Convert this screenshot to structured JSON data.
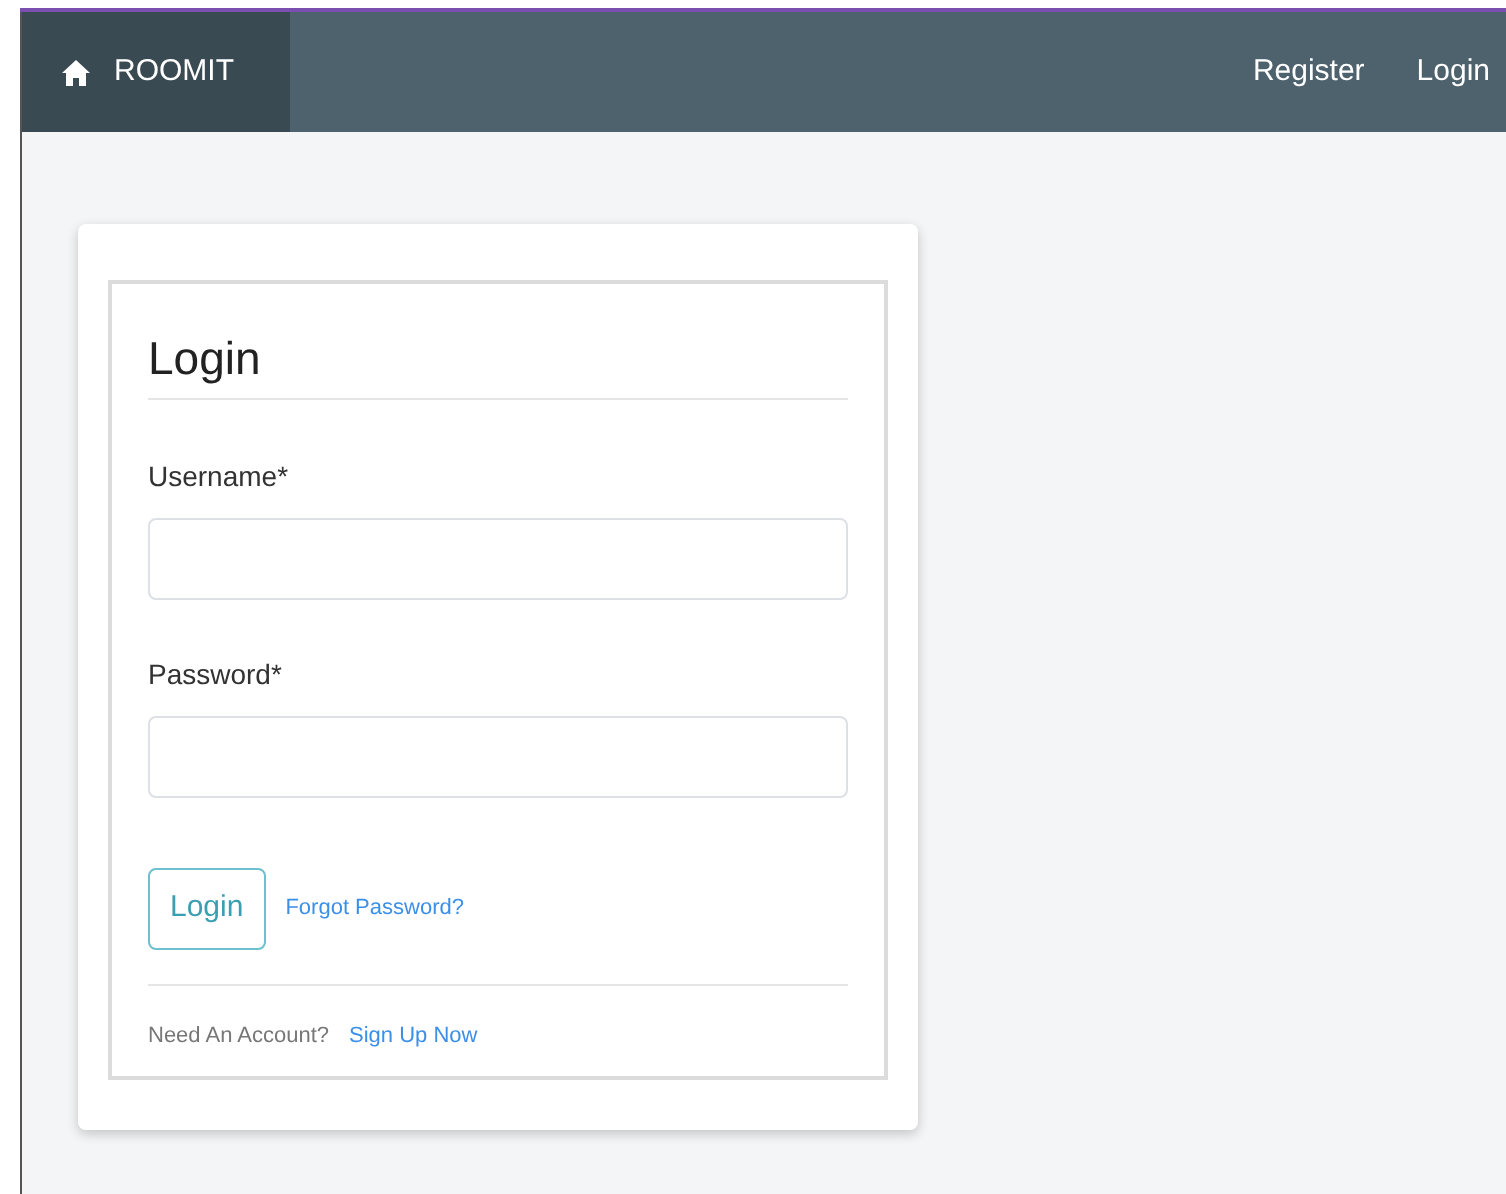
{
  "navbar": {
    "brand": "ROOMIT",
    "links": [
      "Register",
      "Login"
    ]
  },
  "login": {
    "title": "Login",
    "fields": [
      {
        "label": "Username*"
      },
      {
        "label": "Password*"
      }
    ],
    "submit": "Login",
    "forgot": "Forgot Password?",
    "footer_text": "Need An Account?",
    "signup": "Sign Up Now"
  }
}
